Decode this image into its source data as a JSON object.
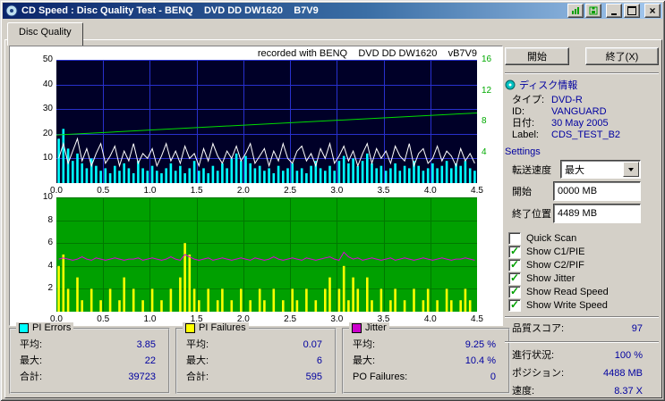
{
  "window": {
    "title": "CD Speed : Disc Quality Test - BENQ    DVD DD DW1620    B7V9"
  },
  "tab": {
    "label": "Disc Quality"
  },
  "chart_header": "recorded with BENQ    DVD DD DW1620    vB7V9",
  "actions": {
    "start": "開始",
    "exit": "終了(X)"
  },
  "disc_info": {
    "title": "ディスク情報",
    "rows": [
      {
        "label": "タイプ:",
        "value": "DVD-R"
      },
      {
        "label": "ID:",
        "value": "VANGUARD"
      },
      {
        "label": "日付:",
        "value": "30 May 2005"
      },
      {
        "label": "Label:",
        "value": "CDS_TEST_B2"
      }
    ]
  },
  "settings": {
    "title": "Settings",
    "speed_label": "転送速度",
    "speed_value": "最大",
    "start_label": "開始",
    "start_value": "0000 MB",
    "end_label": "終了位置",
    "end_value": "4489 MB",
    "checkboxes": [
      {
        "label": "Quick Scan",
        "checked": false
      },
      {
        "label": "Show C1/PIE",
        "checked": true
      },
      {
        "label": "Show C2/PIF",
        "checked": true
      },
      {
        "label": "Show Jitter",
        "checked": true
      },
      {
        "label": "Show Read Speed",
        "checked": true
      },
      {
        "label": "Show Write Speed",
        "checked": true
      }
    ]
  },
  "quality": {
    "label": "品質スコア:",
    "value": "97"
  },
  "status": {
    "rows": [
      {
        "label": "進行状況:",
        "value": "100 %"
      },
      {
        "label": "ポジション:",
        "value": "4488 MB"
      },
      {
        "label": "速度:",
        "value": "8.37 X"
      }
    ]
  },
  "stats": {
    "groups": [
      {
        "title": "PI Errors",
        "swatch": "#00ffff",
        "rows": [
          {
            "label": "平均:",
            "value": "3.85"
          },
          {
            "label": "最大:",
            "value": "22"
          },
          {
            "label": "合計:",
            "value": "39723"
          }
        ]
      },
      {
        "title": "PI Failures",
        "swatch": "#ffff00",
        "rows": [
          {
            "label": "平均:",
            "value": "0.07"
          },
          {
            "label": "最大:",
            "value": "6"
          },
          {
            "label": "合計:",
            "value": "595"
          }
        ]
      },
      {
        "title": "Jitter",
        "swatch": "#cc00cc",
        "rows": [
          {
            "label": "平均:",
            "value": "9.25 %"
          },
          {
            "label": "最大:",
            "value": "10.4 %"
          },
          {
            "label": "PO Failures:",
            "value": "0"
          }
        ]
      }
    ]
  },
  "chart_data": [
    {
      "type": "bar",
      "name": "pi-errors-speed",
      "title": "PI Errors / Read & Write Speed",
      "x_max": 4.5,
      "x_step": 0.5,
      "x_ticks": [
        "0.0",
        "0.5",
        "1.0",
        "1.5",
        "2.0",
        "2.5",
        "3.0",
        "3.5",
        "4.0",
        "4.5"
      ],
      "bg": "#000028",
      "grid_color": "#2830cc",
      "y_left": {
        "max": 50,
        "ticks": [
          10,
          20,
          30,
          40,
          50
        ],
        "color": "#000000"
      },
      "y_right": {
        "max": 16,
        "ticks": [
          4,
          8,
          12,
          16
        ],
        "color": "#00aa00"
      },
      "series": [
        {
          "name": "pi-errors",
          "type": "bar",
          "axis": "left",
          "color": "#00ffff",
          "values": [
            18,
            22,
            14,
            9,
            12,
            8,
            6,
            10,
            7,
            5,
            6,
            4,
            7,
            5,
            8,
            6,
            4,
            9,
            6,
            5,
            7,
            5,
            4,
            6,
            8,
            5,
            7,
            4,
            6,
            9,
            5,
            6,
            4,
            7,
            5,
            8,
            6,
            10,
            12,
            9,
            11,
            8,
            6,
            7,
            5,
            6,
            4,
            7,
            5,
            6,
            8,
            5,
            6,
            4,
            7,
            9,
            6,
            5,
            7,
            5,
            9,
            11,
            8,
            10,
            7,
            9,
            12,
            8,
            6,
            7,
            5,
            6,
            8,
            5,
            7,
            6,
            9,
            7,
            5,
            6,
            8,
            6,
            7,
            9,
            6,
            8,
            7,
            9,
            6,
            5
          ]
        },
        {
          "name": "read-speed-noise",
          "type": "line",
          "axis": "left",
          "color": "#ffffff",
          "values": [
            10,
            16,
            8,
            13,
            18,
            9,
            14,
            7,
            12,
            16,
            8,
            11,
            15,
            7,
            13,
            9,
            16,
            8,
            12,
            10,
            14,
            7,
            11,
            16,
            9,
            13,
            8,
            15,
            10,
            12,
            7,
            14,
            9,
            16,
            11,
            8,
            13,
            10,
            15,
            9,
            12,
            16,
            8,
            11,
            14,
            7,
            13,
            9,
            16,
            10,
            8,
            13,
            15,
            9,
            12,
            7,
            14,
            10,
            16,
            8,
            11,
            15,
            9,
            13,
            7,
            12,
            16,
            8,
            14,
            10,
            13,
            8,
            15,
            11,
            9,
            16,
            7,
            12,
            14,
            8,
            10,
            15,
            9,
            13,
            11,
            7,
            14,
            9,
            12,
            8
          ]
        },
        {
          "name": "write-speed",
          "type": "line",
          "axis": "right",
          "color": "#00dd00",
          "x": [
            0,
            4.5
          ],
          "values": [
            6.25,
            9.1
          ]
        }
      ]
    },
    {
      "type": "bar",
      "name": "pi-failures-jitter",
      "title": "PI Failures / Jitter",
      "x_max": 4.5,
      "x_step": 0.5,
      "x_ticks": [
        "0.0",
        "0.5",
        "1.0",
        "1.5",
        "2.0",
        "2.5",
        "3.0",
        "3.5",
        "4.0",
        "4.5"
      ],
      "bg": "#00a000",
      "grid_color": "#007800",
      "y_left": {
        "max": 10,
        "ticks": [
          2,
          4,
          6,
          8,
          10
        ],
        "color": "#000000"
      },
      "series": [
        {
          "name": "pi-failures",
          "type": "bar",
          "axis": "left",
          "color": "#ffff00",
          "values": [
            4,
            5,
            2,
            0,
            3,
            1,
            0,
            2,
            0,
            1,
            0,
            2,
            0,
            1,
            3,
            0,
            2,
            0,
            1,
            0,
            2,
            0,
            1,
            0,
            2,
            0,
            3,
            6,
            5,
            2,
            1,
            0,
            2,
            0,
            1,
            2,
            0,
            1,
            0,
            2,
            0,
            1,
            0,
            2,
            1,
            0,
            2,
            0,
            1,
            0,
            2,
            1,
            0,
            2,
            0,
            1,
            0,
            2,
            3,
            0,
            2,
            4,
            1,
            3,
            2,
            0,
            3,
            1,
            0,
            2,
            0,
            1,
            2,
            0,
            1,
            0,
            2,
            0,
            1,
            2,
            0,
            1,
            0,
            2,
            1,
            0,
            1,
            2,
            1,
            0
          ]
        },
        {
          "name": "jitter",
          "type": "line",
          "axis": "left",
          "color": "#dd00dd",
          "values": [
            4.6,
            4.7,
            4.6,
            4.5,
            4.6,
            4.8,
            4.6,
            4.5,
            4.7,
            4.6,
            4.5,
            4.6,
            4.7,
            4.6,
            4.5,
            4.6,
            4.6,
            4.7,
            4.5,
            4.6,
            4.7,
            4.6,
            4.5,
            4.6,
            4.8,
            4.6,
            4.5,
            5.0,
            4.8,
            4.6,
            4.5,
            4.6,
            4.7,
            4.5,
            4.6,
            4.7,
            4.6,
            4.5,
            4.6,
            4.7,
            4.6,
            4.5,
            4.7,
            4.6,
            4.5,
            4.6,
            4.8,
            4.6,
            4.5,
            4.6,
            4.7,
            4.6,
            4.5,
            4.7,
            4.6,
            4.5,
            4.6,
            4.7,
            4.8,
            4.6,
            4.5,
            5.2,
            4.8,
            4.6,
            4.7,
            4.5,
            4.6,
            4.7,
            4.6,
            4.5,
            4.6,
            4.7,
            4.5,
            4.6,
            4.7,
            4.6,
            4.5,
            4.6,
            4.7,
            4.6,
            4.5,
            4.6,
            4.7,
            4.6,
            4.5,
            4.6,
            4.6,
            4.7,
            4.6,
            4.5
          ]
        }
      ]
    }
  ]
}
